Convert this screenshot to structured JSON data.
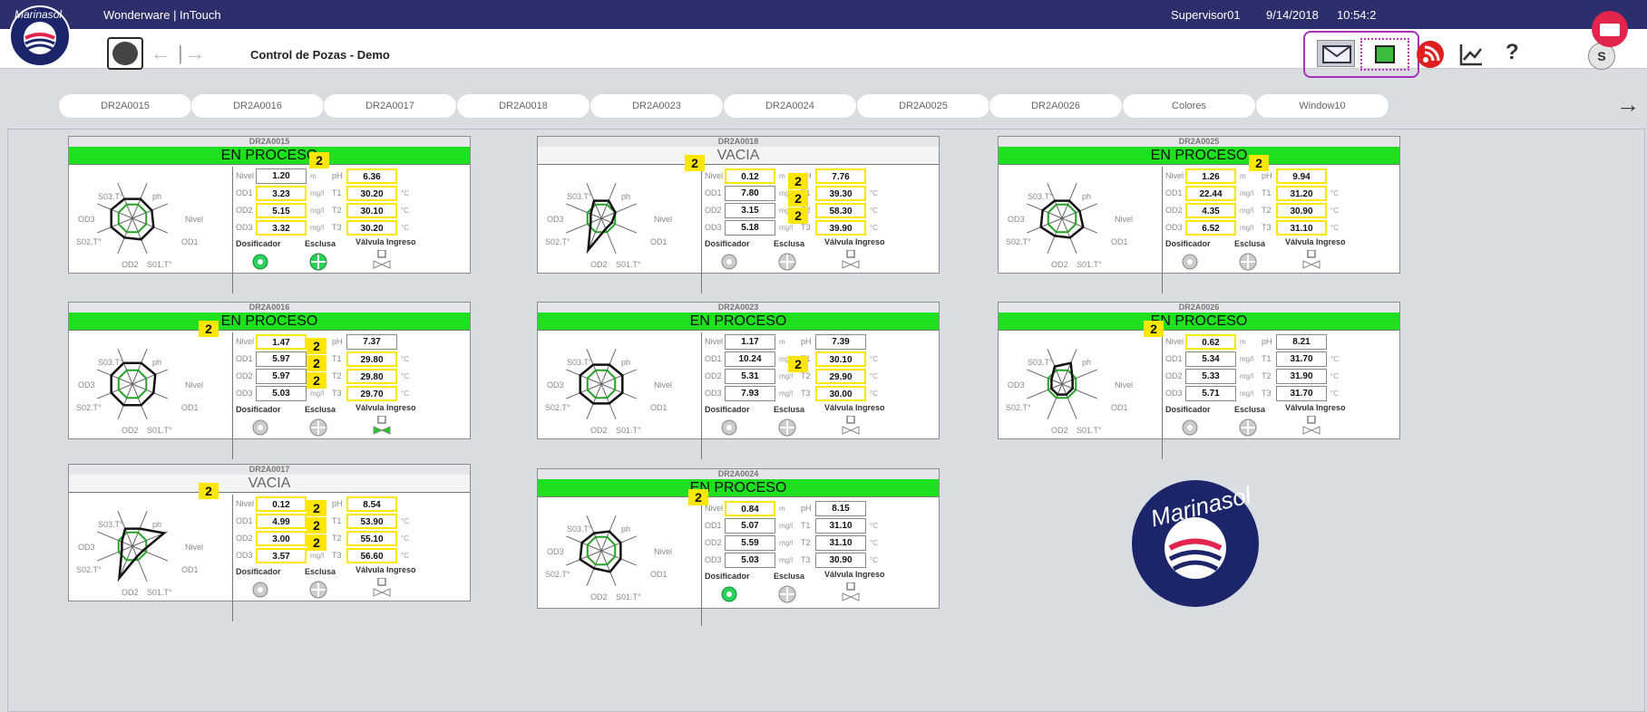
{
  "app": {
    "title": "Wonderware | InTouch",
    "user": "Supervisor01",
    "date": "9/14/2018",
    "time": "10:54:2"
  },
  "toolbar": {
    "page_title": "Control de Pozas - Demo",
    "help": "?",
    "user_initial": "S"
  },
  "logo_text": "Marinasol",
  "tabs": [
    "DR2A0015",
    "DR2A0016",
    "DR2A0017",
    "DR2A0018",
    "DR2A0023",
    "DR2A0024",
    "DR2A0025",
    "DR2A0026",
    "Colores",
    "Window10"
  ],
  "labels": {
    "nivel": "Nivel",
    "ph": "pH",
    "od1": "OD1",
    "od2": "OD2",
    "od3": "OD3",
    "t1": "T1",
    "t2": "T2",
    "t3": "T3",
    "m": "m",
    "mgl": "mg/l",
    "c": "°C",
    "dosificador": "Dosificador",
    "esclusa": "Esclusa",
    "valvula": "Válvula Ingreso",
    "radar": {
      "s03": "S03.T°",
      "ph": "ph",
      "od3": "OD3",
      "nivel": "Nivel",
      "s02": "S02.T°",
      "od1": "OD1",
      "od2": "OD2",
      "s01": "S01.T°"
    },
    "badge": "2"
  },
  "colors": {
    "green": "#1fe01f",
    "yellow": "#ffe600",
    "navy": "#2c2f6b",
    "accent": "#e3244d"
  },
  "cards": [
    {
      "name": "DR2A0015",
      "state": "EN PROCESO",
      "vacia": false,
      "nivel": "1.20",
      "ph": "6.36",
      "od1": "3.23",
      "od2": "5.15",
      "od3": "3.32",
      "t1": "30.20",
      "t2": "30.10",
      "t3": "30.20"
    },
    {
      "name": "DR2A0018",
      "state": "VACIA",
      "vacia": true,
      "nivel": "0.12",
      "ph": "7.76",
      "od1": "7.80",
      "od2": "3.15",
      "od3": "5.18",
      "t1": "39.30",
      "t2": "58.30",
      "t3": "39.90"
    },
    {
      "name": "DR2A0025",
      "state": "EN PROCESO",
      "vacia": false,
      "nivel": "1.26",
      "ph": "9.94",
      "od1": "22.44",
      "od2": "4.35",
      "od3": "6.52",
      "t1": "31.20",
      "t2": "30.90",
      "t3": "31.10"
    },
    {
      "name": "DR2A0016",
      "state": "EN PROCESO",
      "vacia": false,
      "nivel": "1.47",
      "ph": "7.37",
      "od1": "5.97",
      "od2": "5.97",
      "od3": "5.03",
      "t1": "29.80",
      "t2": "29.80",
      "t3": "29.70"
    },
    {
      "name": "DR2A0023",
      "state": "EN PROCESO",
      "vacia": false,
      "nivel": "1.17",
      "ph": "7.39",
      "od1": "10.24",
      "od2": "5.31",
      "od3": "7.93",
      "t1": "30.10",
      "t2": "29.90",
      "t3": "30.00"
    },
    {
      "name": "DR2A0026",
      "state": "EN PROCESO",
      "vacia": false,
      "nivel": "0.62",
      "ph": "8.21",
      "od1": "5.34",
      "od2": "5.33",
      "od3": "5.71",
      "t1": "31.70",
      "t2": "31.90",
      "t3": "31.70"
    },
    {
      "name": "DR2A0017",
      "state": "VACIA",
      "vacia": true,
      "nivel": "0.12",
      "ph": "8.54",
      "od1": "4.99",
      "od2": "3.00",
      "od3": "3.57",
      "t1": "53.90",
      "t2": "55.10",
      "t3": "56.60"
    },
    {
      "name": "DR2A0024",
      "state": "EN PROCESO",
      "vacia": false,
      "nivel": "0.84",
      "ph": "8.15",
      "od1": "5.07",
      "od2": "5.59",
      "od3": "5.03",
      "t1": "31.10",
      "t2": "31.10",
      "t3": "30.90"
    }
  ]
}
